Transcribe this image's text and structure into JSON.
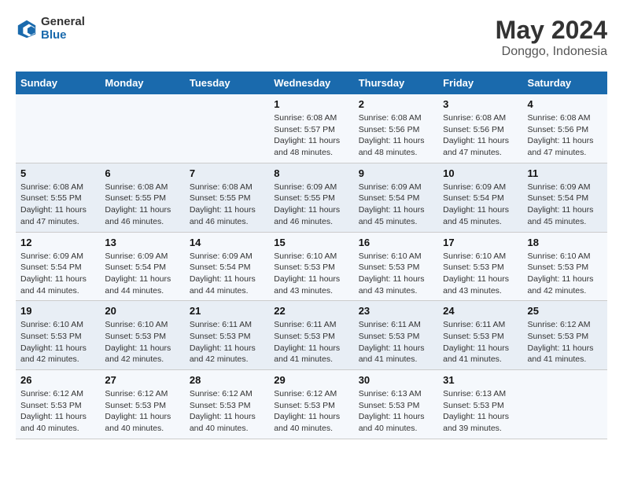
{
  "logo": {
    "general": "General",
    "blue": "Blue"
  },
  "title": "May 2024",
  "subtitle": "Donggo, Indonesia",
  "days_header": [
    "Sunday",
    "Monday",
    "Tuesday",
    "Wednesday",
    "Thursday",
    "Friday",
    "Saturday"
  ],
  "weeks": [
    [
      {
        "day": "",
        "info": ""
      },
      {
        "day": "",
        "info": ""
      },
      {
        "day": "",
        "info": ""
      },
      {
        "day": "1",
        "info": "Sunrise: 6:08 AM\nSunset: 5:57 PM\nDaylight: 11 hours\nand 48 minutes."
      },
      {
        "day": "2",
        "info": "Sunrise: 6:08 AM\nSunset: 5:56 PM\nDaylight: 11 hours\nand 48 minutes."
      },
      {
        "day": "3",
        "info": "Sunrise: 6:08 AM\nSunset: 5:56 PM\nDaylight: 11 hours\nand 47 minutes."
      },
      {
        "day": "4",
        "info": "Sunrise: 6:08 AM\nSunset: 5:56 PM\nDaylight: 11 hours\nand 47 minutes."
      }
    ],
    [
      {
        "day": "5",
        "info": "Sunrise: 6:08 AM\nSunset: 5:55 PM\nDaylight: 11 hours\nand 47 minutes."
      },
      {
        "day": "6",
        "info": "Sunrise: 6:08 AM\nSunset: 5:55 PM\nDaylight: 11 hours\nand 46 minutes."
      },
      {
        "day": "7",
        "info": "Sunrise: 6:08 AM\nSunset: 5:55 PM\nDaylight: 11 hours\nand 46 minutes."
      },
      {
        "day": "8",
        "info": "Sunrise: 6:09 AM\nSunset: 5:55 PM\nDaylight: 11 hours\nand 46 minutes."
      },
      {
        "day": "9",
        "info": "Sunrise: 6:09 AM\nSunset: 5:54 PM\nDaylight: 11 hours\nand 45 minutes."
      },
      {
        "day": "10",
        "info": "Sunrise: 6:09 AM\nSunset: 5:54 PM\nDaylight: 11 hours\nand 45 minutes."
      },
      {
        "day": "11",
        "info": "Sunrise: 6:09 AM\nSunset: 5:54 PM\nDaylight: 11 hours\nand 45 minutes."
      }
    ],
    [
      {
        "day": "12",
        "info": "Sunrise: 6:09 AM\nSunset: 5:54 PM\nDaylight: 11 hours\nand 44 minutes."
      },
      {
        "day": "13",
        "info": "Sunrise: 6:09 AM\nSunset: 5:54 PM\nDaylight: 11 hours\nand 44 minutes."
      },
      {
        "day": "14",
        "info": "Sunrise: 6:09 AM\nSunset: 5:54 PM\nDaylight: 11 hours\nand 44 minutes."
      },
      {
        "day": "15",
        "info": "Sunrise: 6:10 AM\nSunset: 5:53 PM\nDaylight: 11 hours\nand 43 minutes."
      },
      {
        "day": "16",
        "info": "Sunrise: 6:10 AM\nSunset: 5:53 PM\nDaylight: 11 hours\nand 43 minutes."
      },
      {
        "day": "17",
        "info": "Sunrise: 6:10 AM\nSunset: 5:53 PM\nDaylight: 11 hours\nand 43 minutes."
      },
      {
        "day": "18",
        "info": "Sunrise: 6:10 AM\nSunset: 5:53 PM\nDaylight: 11 hours\nand 42 minutes."
      }
    ],
    [
      {
        "day": "19",
        "info": "Sunrise: 6:10 AM\nSunset: 5:53 PM\nDaylight: 11 hours\nand 42 minutes."
      },
      {
        "day": "20",
        "info": "Sunrise: 6:10 AM\nSunset: 5:53 PM\nDaylight: 11 hours\nand 42 minutes."
      },
      {
        "day": "21",
        "info": "Sunrise: 6:11 AM\nSunset: 5:53 PM\nDaylight: 11 hours\nand 42 minutes."
      },
      {
        "day": "22",
        "info": "Sunrise: 6:11 AM\nSunset: 5:53 PM\nDaylight: 11 hours\nand 41 minutes."
      },
      {
        "day": "23",
        "info": "Sunrise: 6:11 AM\nSunset: 5:53 PM\nDaylight: 11 hours\nand 41 minutes."
      },
      {
        "day": "24",
        "info": "Sunrise: 6:11 AM\nSunset: 5:53 PM\nDaylight: 11 hours\nand 41 minutes."
      },
      {
        "day": "25",
        "info": "Sunrise: 6:12 AM\nSunset: 5:53 PM\nDaylight: 11 hours\nand 41 minutes."
      }
    ],
    [
      {
        "day": "26",
        "info": "Sunrise: 6:12 AM\nSunset: 5:53 PM\nDaylight: 11 hours\nand 40 minutes."
      },
      {
        "day": "27",
        "info": "Sunrise: 6:12 AM\nSunset: 5:53 PM\nDaylight: 11 hours\nand 40 minutes."
      },
      {
        "day": "28",
        "info": "Sunrise: 6:12 AM\nSunset: 5:53 PM\nDaylight: 11 hours\nand 40 minutes."
      },
      {
        "day": "29",
        "info": "Sunrise: 6:12 AM\nSunset: 5:53 PM\nDaylight: 11 hours\nand 40 minutes."
      },
      {
        "day": "30",
        "info": "Sunrise: 6:13 AM\nSunset: 5:53 PM\nDaylight: 11 hours\nand 40 minutes."
      },
      {
        "day": "31",
        "info": "Sunrise: 6:13 AM\nSunset: 5:53 PM\nDaylight: 11 hours\nand 39 minutes."
      },
      {
        "day": "",
        "info": ""
      }
    ]
  ]
}
